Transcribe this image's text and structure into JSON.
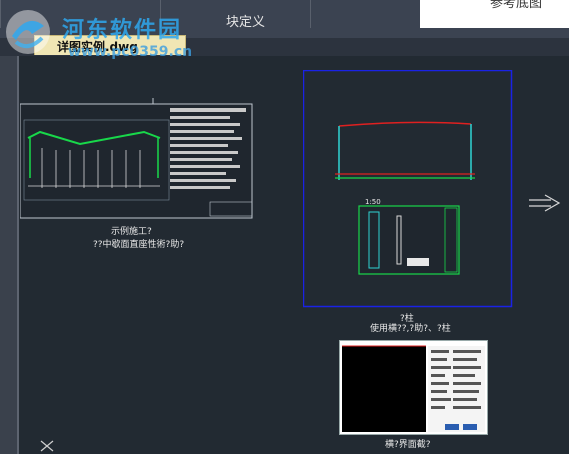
{
  "ribbon": {
    "block_panel_label": "块定义",
    "right_panel_text": "参考底图"
  },
  "tab": {
    "label": "详图实例.dwg"
  },
  "watermark": {
    "name": "河东软件园",
    "url": "www.pc0359.cn"
  },
  "drawings": {
    "sheet1": {
      "title": "示例施工?",
      "subtitle": "??中歇面直座性術?助?"
    },
    "sheet2": {
      "scale": "1:50",
      "title": "?柱",
      "subtitle": "使用横??,?助?、?柱"
    },
    "sheet3": {
      "title": "横?界面截?"
    }
  },
  "colors": {
    "canvas": "#222a32",
    "frame_blue": "#1a22e6",
    "cad_green": "#18d84a",
    "cad_cyan": "#2fd4d4",
    "cad_red": "#e02020"
  },
  "icons": {
    "next": "arrow-right-icon",
    "ucs": "ucs-icon",
    "logo": "watermark-logo-icon"
  }
}
